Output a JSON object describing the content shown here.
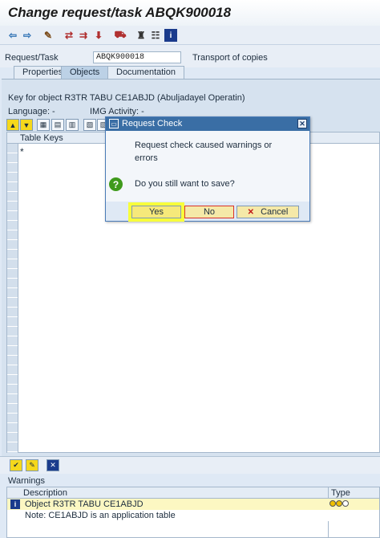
{
  "window": {
    "title": "Change request/task ABQK900018"
  },
  "toolbar": {
    "icons": [
      "back-arrow-icon",
      "forward-arrow-icon",
      "edit-icon",
      "display-icon",
      "change-icon",
      "save-icon",
      "transport-icon",
      "hierarchy-icon",
      "object-list-icon",
      "info-icon"
    ]
  },
  "header": {
    "request_label": "Request/Task",
    "request_value": "ABQK900018",
    "request_type": "Transport of copies"
  },
  "tabs": [
    {
      "label": "Properties",
      "active": false
    },
    {
      "label": "Objects",
      "active": true
    },
    {
      "label": "Documentation",
      "active": false
    }
  ],
  "panel": {
    "key_text": "Key for object R3TR TABU CE1ABJD (Abuljadayel Operatin)",
    "language_label": "Language: -",
    "img_activity_label": "IMG Activity: -",
    "table_header": "Table Keys",
    "first_row": "*"
  },
  "dialog": {
    "title": "Request Check",
    "message": "Request check caused warnings or errors",
    "question": "Do you still want to save?",
    "buttons": {
      "yes": "Yes",
      "no": "No",
      "cancel": "Cancel"
    }
  },
  "warnings": {
    "title": "Warnings",
    "columns": {
      "description": "Description",
      "type": "Type"
    },
    "rows": [
      {
        "description": "Object R3TR TABU CE1ABJD"
      },
      {
        "description": "Note: CE1ABJD is an application table"
      }
    ]
  },
  "colors": {
    "accent": "#3a6ea5",
    "highlight": "#f8ff3b",
    "info": "#1a3b8c"
  }
}
